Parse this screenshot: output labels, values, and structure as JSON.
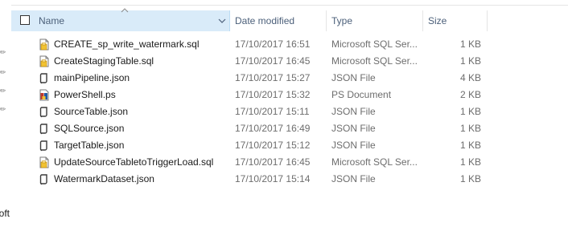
{
  "colors": {
    "header_selected_bg": "#d9ebf9",
    "header_text": "#4c607a",
    "secondary_text": "#6d6d6d"
  },
  "nav": {
    "fragment_text": "oft"
  },
  "header": {
    "name_label": "Name",
    "date_label": "Date modified",
    "type_label": "Type",
    "size_label": "Size",
    "sort_icon": "chevron-up-icon"
  },
  "files": [
    {
      "name": "CREATE_sp_write_watermark.sql",
      "date": "17/10/2017 16:51",
      "type": "Microsoft SQL Ser...",
      "size": "1 KB",
      "icon": "sql-file-icon"
    },
    {
      "name": "CreateStagingTable.sql",
      "date": "17/10/2017 16:45",
      "type": "Microsoft SQL Ser...",
      "size": "1 KB",
      "icon": "sql-file-icon"
    },
    {
      "name": "mainPipeline.json",
      "date": "17/10/2017 15:27",
      "type": "JSON File",
      "size": "4 KB",
      "icon": "json-file-icon"
    },
    {
      "name": "PowerShell.ps",
      "date": "17/10/2017 15:32",
      "type": "PS Document",
      "size": "2 KB",
      "icon": "ps-file-icon"
    },
    {
      "name": "SourceTable.json",
      "date": "17/10/2017 15:11",
      "type": "JSON File",
      "size": "1 KB",
      "icon": "json-file-icon"
    },
    {
      "name": "SQLSource.json",
      "date": "17/10/2017 16:49",
      "type": "JSON File",
      "size": "1 KB",
      "icon": "json-file-icon"
    },
    {
      "name": "TargetTable.json",
      "date": "17/10/2017 15:12",
      "type": "JSON File",
      "size": "1 KB",
      "icon": "json-file-icon"
    },
    {
      "name": "UpdateSourceTabletoTriggerLoad.sql",
      "date": "17/10/2017 16:45",
      "type": "Microsoft SQL Ser...",
      "size": "1 KB",
      "icon": "sql-file-icon"
    },
    {
      "name": "WatermarkDataset.json",
      "date": "17/10/2017 15:14",
      "type": "JSON File",
      "size": "1 KB",
      "icon": "json-file-icon"
    }
  ]
}
